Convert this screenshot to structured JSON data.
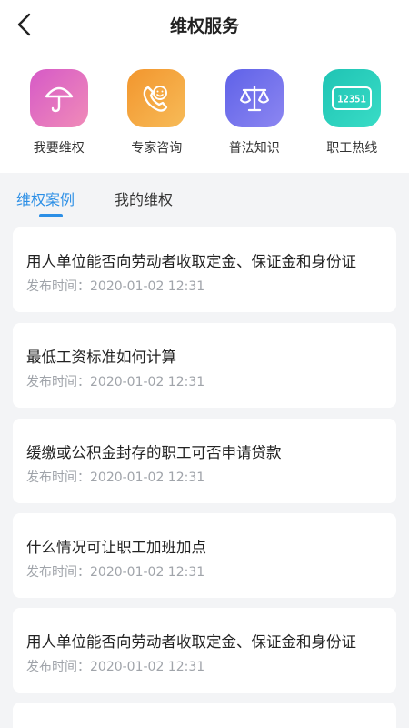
{
  "header": {
    "title": "维权服务"
  },
  "features": [
    {
      "label": "我要维权",
      "icon": "umbrella-icon",
      "colors": [
        "#d65ac7",
        "#f08bb8"
      ]
    },
    {
      "label": "专家咨询",
      "icon": "phone-smile-icon",
      "colors": [
        "#f2962e",
        "#f7bb58"
      ]
    },
    {
      "label": "普法知识",
      "icon": "balance-scale-icon",
      "colors": [
        "#5f62e8",
        "#8c86f1"
      ]
    },
    {
      "label": "职工热线",
      "icon": "hotline-12351-icon",
      "colors": [
        "#1fc4b4",
        "#39dcc6"
      ],
      "badge_text": "12351"
    }
  ],
  "tabs": [
    {
      "label": "维权案例",
      "active": true
    },
    {
      "label": "我的维权",
      "active": false
    }
  ],
  "meta_prefix": "发布时间：",
  "cards": [
    {
      "title": "用人单位能否向劳动者收取定金、保证金和身份证",
      "time": "2020-01-02 12:31"
    },
    {
      "title": "最低工资标准如何计算",
      "time": "2020-01-02 12:31"
    },
    {
      "title": "缓缴或公积金封存的职工可否申请贷款",
      "time": "2020-01-02 12:31"
    },
    {
      "title": "什么情况可让职工加班加点",
      "time": "2020-01-02 12:31"
    },
    {
      "title": "用人单位能否向劳动者收取定金、保证金和身份证",
      "time": "2020-01-02 12:31"
    }
  ],
  "colors": {
    "accent": "#2c8fe6",
    "background": "#f3f4f6"
  }
}
